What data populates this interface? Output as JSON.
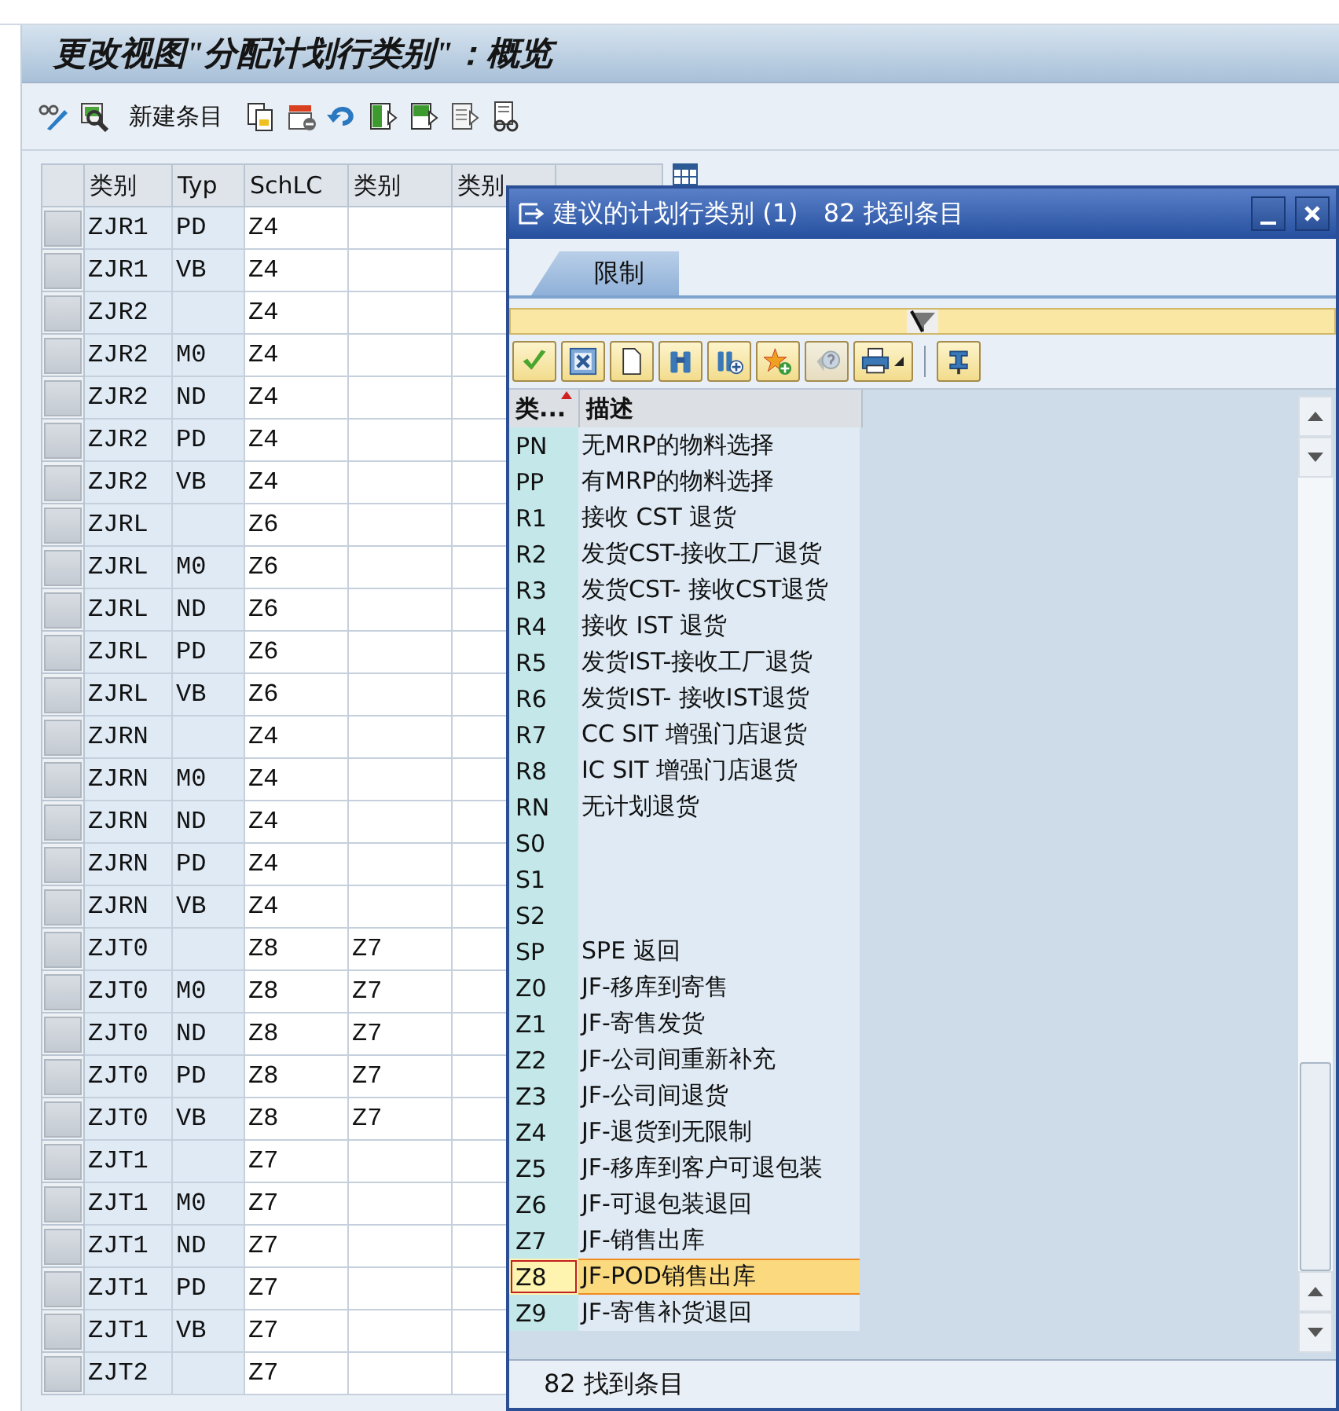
{
  "window": {
    "title": "更改视图\"分配计划行类别\"：概览"
  },
  "toolbar": {
    "new_entry_label": "新建条目"
  },
  "table": {
    "columns": [
      "类别",
      "Typ",
      "SchLC",
      "类别",
      "类别"
    ],
    "rows": [
      {
        "category": "ZJR1",
        "typ": "PD",
        "schlc": "Z4"
      },
      {
        "category": "ZJR1",
        "typ": "VB",
        "schlc": "Z4"
      },
      {
        "category": "ZJR2",
        "schlc": "Z4"
      },
      {
        "category": "ZJR2",
        "typ": "M0",
        "schlc": "Z4"
      },
      {
        "category": "ZJR2",
        "typ": "ND",
        "schlc": "Z4"
      },
      {
        "category": "ZJR2",
        "typ": "PD",
        "schlc": "Z4"
      },
      {
        "category": "ZJR2",
        "typ": "VB",
        "schlc": "Z4"
      },
      {
        "category": "ZJRL",
        "schlc": "Z6"
      },
      {
        "category": "ZJRL",
        "typ": "M0",
        "schlc": "Z6"
      },
      {
        "category": "ZJRL",
        "typ": "ND",
        "schlc": "Z6"
      },
      {
        "category": "ZJRL",
        "typ": "PD",
        "schlc": "Z6"
      },
      {
        "category": "ZJRL",
        "typ": "VB",
        "schlc": "Z6"
      },
      {
        "category": "ZJRN",
        "schlc": "Z4"
      },
      {
        "category": "ZJRN",
        "typ": "M0",
        "schlc": "Z4"
      },
      {
        "category": "ZJRN",
        "typ": "ND",
        "schlc": "Z4"
      },
      {
        "category": "ZJRN",
        "typ": "PD",
        "schlc": "Z4"
      },
      {
        "category": "ZJRN",
        "typ": "VB",
        "schlc": "Z4"
      },
      {
        "category": "ZJT0",
        "schlc": "Z8",
        "column_4": "Z7"
      },
      {
        "category": "ZJT0",
        "typ": "M0",
        "schlc": "Z8",
        "column_4": "Z7"
      },
      {
        "category": "ZJT0",
        "typ": "ND",
        "schlc": "Z8",
        "column_4": "Z7"
      },
      {
        "category": "ZJT0",
        "typ": "PD",
        "schlc": "Z8",
        "column_4": "Z7"
      },
      {
        "category": "ZJT0",
        "typ": "VB",
        "schlc": "Z8",
        "column_4": "Z7"
      },
      {
        "category": "ZJT1",
        "schlc": "Z7"
      },
      {
        "category": "ZJT1",
        "typ": "M0",
        "schlc": "Z7"
      },
      {
        "category": "ZJT1",
        "typ": "ND",
        "schlc": "Z7"
      },
      {
        "category": "ZJT1",
        "typ": "PD",
        "schlc": "Z7"
      },
      {
        "category": "ZJT1",
        "typ": "VB",
        "schlc": "Z7"
      },
      {
        "category": "ZJT2",
        "schlc": "Z7"
      }
    ]
  },
  "popup": {
    "title": "建议的计划行类别 (1)",
    "count": "82 找到条目",
    "tabs": [
      {
        "label": "限制",
        "selected": true
      }
    ],
    "columns": [
      {
        "label": "类...",
        "sorted": true
      },
      {
        "label": "描述",
        "sorted": false
      }
    ],
    "rows": [
      {
        "code": "PN",
        "description": "无MRP的物料选择",
        "selected": false
      },
      {
        "code": "PP",
        "description": "有MRP的物料选择",
        "selected": false
      },
      {
        "code": "R1",
        "description": "接收 CST 退货",
        "selected": false
      },
      {
        "code": "R2",
        "description": "发货CST-接收工厂退货",
        "selected": false
      },
      {
        "code": "R3",
        "description": "发货CST- 接收CST退货",
        "selected": false
      },
      {
        "code": "R4",
        "description": "接收 IST 退货",
        "selected": false
      },
      {
        "code": "R5",
        "description": "发货IST-接收工厂退货",
        "selected": false
      },
      {
        "code": "R6",
        "description": "发货IST- 接收IST退货",
        "selected": false
      },
      {
        "code": "R7",
        "description": "CC SIT 增强门店退货",
        "selected": false
      },
      {
        "code": "R8",
        "description": "IC SIT 增强门店退货",
        "selected": false
      },
      {
        "code": "RN",
        "description": "无计划退货",
        "selected": false
      },
      {
        "code": "S0",
        "selected": false
      },
      {
        "code": "S1",
        "selected": false
      },
      {
        "code": "S2",
        "selected": false
      },
      {
        "code": "SP",
        "description": "SPE 返回",
        "selected": false
      },
      {
        "code": "Z0",
        "description": "JF-移库到寄售",
        "selected": false
      },
      {
        "code": "Z1",
        "description": "JF-寄售发货",
        "selected": false
      },
      {
        "code": "Z2",
        "description": "JF-公司间重新补充",
        "selected": false
      },
      {
        "code": "Z3",
        "description": "JF-公司间退货",
        "selected": false
      },
      {
        "code": "Z4",
        "description": "JF-退货到无限制",
        "selected": false
      },
      {
        "code": "Z5",
        "description": "JF-移库到客户可退包装",
        "selected": false
      },
      {
        "code": "Z6",
        "description": "JF-可退包装退回",
        "selected": false
      },
      {
        "code": "Z7",
        "description": "JF-销售出库",
        "selected": false
      },
      {
        "code": "Z8",
        "description": "JF-POD销售出库",
        "selected": true
      },
      {
        "code": "Z9",
        "description": "JF-寄售补货退回",
        "selected": false
      }
    ],
    "status": "82 找到条目"
  }
}
